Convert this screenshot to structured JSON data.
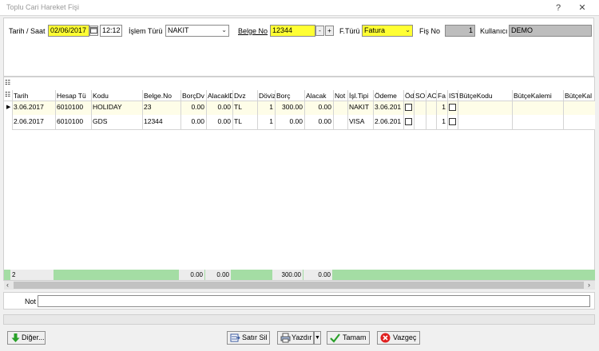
{
  "window": {
    "title": "Toplu Cari Hareket Fişi",
    "help": "?",
    "close": "✕"
  },
  "form": {
    "tarih_saat_label": "Tarih / Saat",
    "date": "02/06/2017",
    "time": "12:12",
    "islem_turu_label": "İşlem Türü",
    "islem_turu_value": "NAKIT",
    "belge_no_label": "Belge No",
    "belge_no_value": "12344",
    "minus": "-",
    "plus": "+",
    "f_turu_label": "F.Türü",
    "f_turu_value": "Fatura",
    "fis_no_label": "Fiş No",
    "fis_no_value": "1",
    "kullanici_label": "Kullanıcı",
    "kullanici_value": "DEMO"
  },
  "grid": {
    "headers": [
      "Tarih",
      "Hesap Tü",
      "Kodu",
      "Belge.No",
      "BorçDv",
      "AlacaklD",
      "Dvz",
      "Döviz",
      "Borç",
      "Alacak",
      "Not",
      "İşl.Tipi",
      "Ödeme",
      "Öd",
      "SO",
      "AC",
      "Fa",
      "IST",
      "BütçeKodu",
      "BütçeKalemi",
      "BütçeKal"
    ],
    "rows": [
      [
        "3.06.2017",
        "6010100",
        "HOLIDAY",
        "23",
        "0.00",
        "0.00",
        "TL",
        "1",
        "300.00",
        "0.00",
        "",
        "NAKIT",
        "3.06.201",
        "",
        "",
        "",
        "1",
        "",
        "",
        "",
        ""
      ],
      [
        "2.06.2017",
        "6010100",
        "GDS",
        "12344",
        "0.00",
        "0.00",
        "TL",
        "1",
        "0.00",
        "0.00",
        "",
        "VISA",
        "2.06.201",
        "",
        "",
        "",
        "1",
        "",
        "",
        "",
        ""
      ]
    ],
    "footer": {
      "count": "2",
      "borc_dv": "0.00",
      "alacak_dv": "0.00",
      "borc": "300.00",
      "alacak": "0.00"
    }
  },
  "not_label": "Not",
  "not_value": "",
  "buttons": {
    "diger": "Diğer...",
    "satir_sil": "Satır Sil",
    "yazdir": "Yazdır",
    "tamam": "Tamam",
    "vazgec": "Vazgeç"
  },
  "colors": {
    "highlight": "#ffff33",
    "footer_green": "#a4dda4",
    "selected_row": "#fefde8"
  }
}
